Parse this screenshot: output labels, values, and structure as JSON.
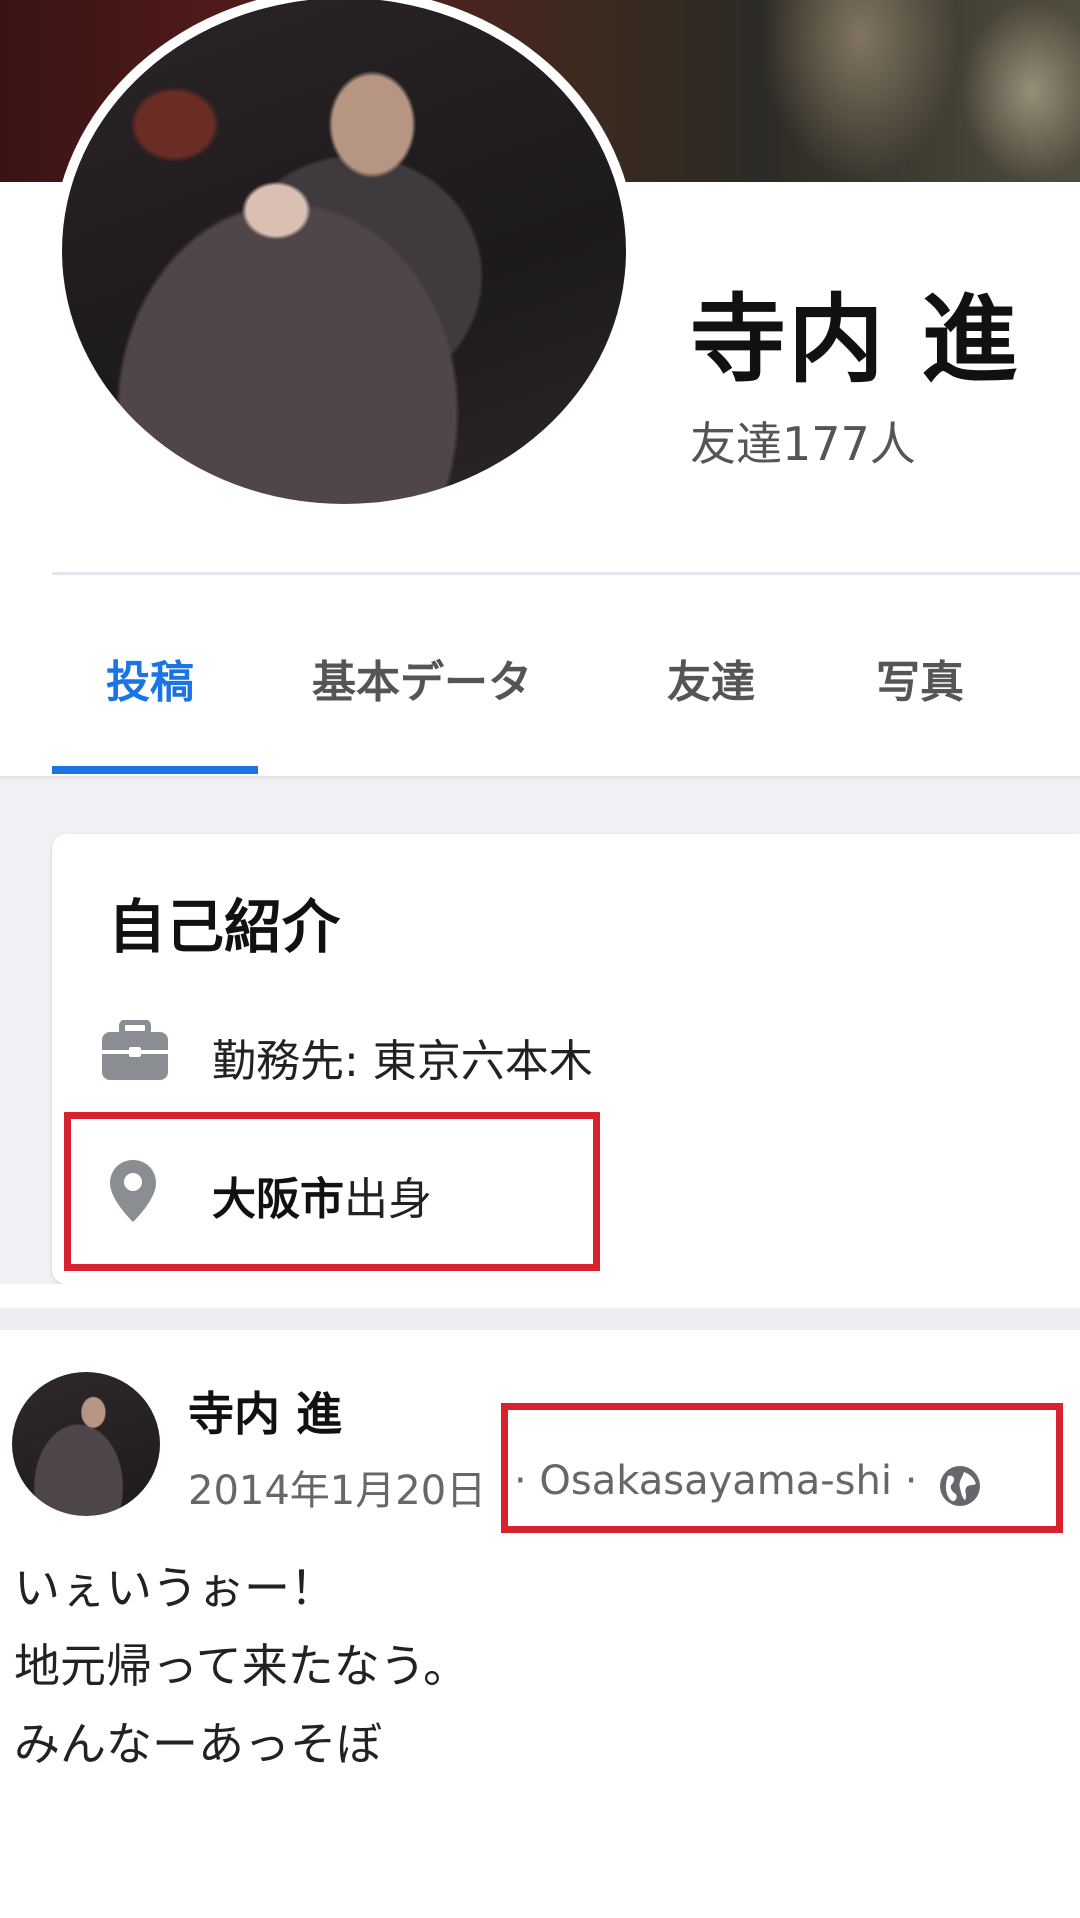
{
  "profile": {
    "name": "寺内 進",
    "friends_label": "友達177人"
  },
  "tabs": [
    {
      "label": "投稿",
      "active": true
    },
    {
      "label": "基本データ",
      "active": false
    },
    {
      "label": "友達",
      "active": false
    },
    {
      "label": "写真",
      "active": false
    }
  ],
  "intro": {
    "title": "自己紹介",
    "work": {
      "icon": "briefcase-icon",
      "text": "勤務先: 東京六本木"
    },
    "hometown": {
      "icon": "location-pin-icon",
      "city": "大阪市",
      "suffix": "出身"
    }
  },
  "post": {
    "author": "寺内 進",
    "date": "2014年1月20日",
    "location": "· Osakasayama-shi ·",
    "privacy_icon": "globe-icon",
    "lines": [
      "いぇいうぉー！",
      "地元帰って来たなう。",
      "みんなーあっそぼ"
    ]
  },
  "colors": {
    "accent": "#1b74e4",
    "highlight_box": "#d8232f",
    "muted_text": "#65676b",
    "icon_gray": "#8a8d91"
  }
}
